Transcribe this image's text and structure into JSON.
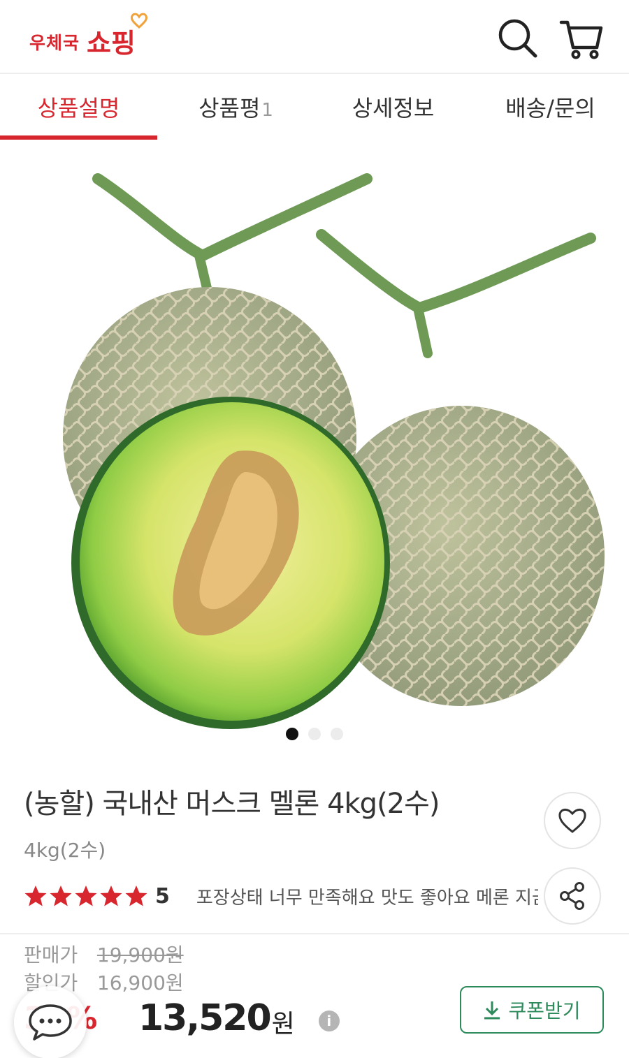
{
  "header": {
    "logo_small": "우체국",
    "logo_big": "쇼핑",
    "search_icon": "search-icon",
    "cart_icon": "cart-icon"
  },
  "tabs": [
    {
      "label": "상품설명",
      "active": true
    },
    {
      "label": "상품평",
      "count": "1"
    },
    {
      "label": "상세정보"
    },
    {
      "label": "배송/문의"
    }
  ],
  "gallery": {
    "image": "two cantaloupe muskmelons, one cut in half",
    "current_slide": 1,
    "total_slides": 3
  },
  "product": {
    "title": "(농할) 국내산 머스크 멜론 4kg(2수)",
    "option": "4kg(2수)",
    "rating_value": "5",
    "stars_filled": 5,
    "stars_total": 5,
    "review_snippet": "포장상태 너무 만족해요 맛도 좋아요 메론 지금 딱",
    "like_icon": "heart-icon",
    "share_icon": "share-icon"
  },
  "pricing": {
    "orig_label": "판매가",
    "orig_price": "19,900원",
    "sale_label": "할인가",
    "sale_price": "16,900원",
    "discount": "32%",
    "final_price": "13,520",
    "final_unit": "원",
    "info_icon": "i"
  },
  "coupon": {
    "label": "쿠폰받기",
    "icon": "download-icon"
  },
  "chat": {
    "icon": "chat-bubble-icon"
  },
  "colors": {
    "brand_red": "#d8262e",
    "coupon_green": "#2d8a5b"
  }
}
